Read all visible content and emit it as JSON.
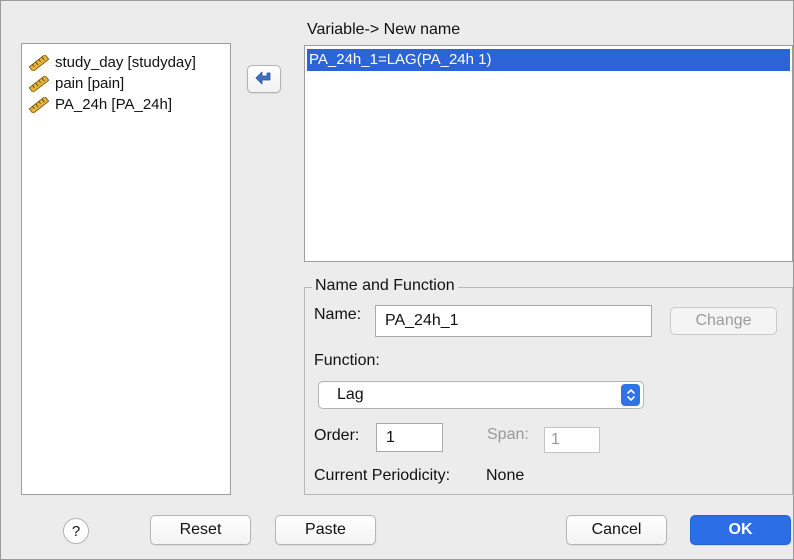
{
  "variables": [
    {
      "label": "study_day [studyday]",
      "icon": "ruler-icon"
    },
    {
      "label": "pain [pain]",
      "icon": "ruler-icon"
    },
    {
      "label": "PA_24h [PA_24h]",
      "icon": "ruler-icon"
    }
  ],
  "target": {
    "heading": "Variable-> New name",
    "items": [
      "PA_24h_1=LAG(PA_24h 1)"
    ]
  },
  "name_function": {
    "group_title": "Name and Function",
    "name_label": "Name:",
    "name_value": "PA_24h_1",
    "change_label": "Change",
    "function_label": "Function:",
    "function_value": "Lag",
    "order_label": "Order:",
    "order_value": "1",
    "span_label": "Span:",
    "span_value": "1",
    "periodicity_label": "Current Periodicity:",
    "periodicity_value": "None"
  },
  "buttons": {
    "help": "?",
    "reset": "Reset",
    "paste": "Paste",
    "cancel": "Cancel",
    "ok": "OK"
  },
  "colors": {
    "selection": "#2a64d6",
    "ok": "#2c6ee6",
    "ruler": "#e5b23a"
  }
}
